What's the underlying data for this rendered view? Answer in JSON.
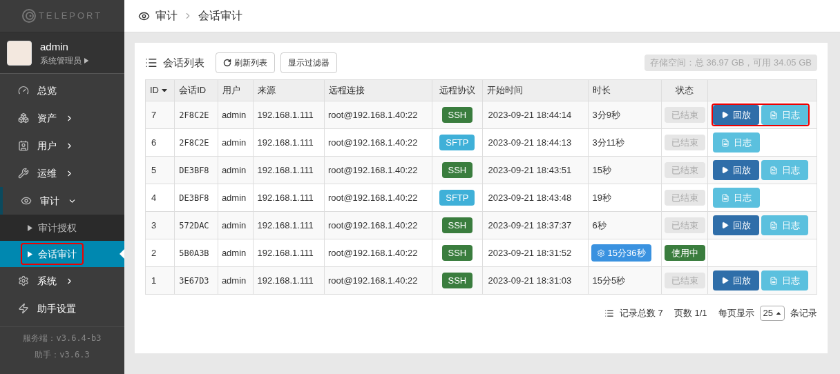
{
  "logo": {
    "text": "TELEPORT"
  },
  "user": {
    "name": "admin",
    "role": "系统管理员"
  },
  "nav": [
    {
      "label": "总览"
    },
    {
      "label": "资产",
      "expandable": true,
      "expanded": false
    },
    {
      "label": "用户",
      "expandable": true,
      "expanded": false
    },
    {
      "label": "运维",
      "expandable": true,
      "expanded": false
    },
    {
      "label": "审计",
      "expandable": true,
      "expanded": true,
      "children": [
        {
          "label": "审计授权",
          "selected": false,
          "highlighted": false
        },
        {
          "label": "会话审计",
          "selected": true,
          "highlighted": true
        }
      ]
    },
    {
      "label": "系统",
      "expandable": true,
      "expanded": false
    },
    {
      "label": "助手设置"
    }
  ],
  "versions": [
    "服务端：v3.6.4-b3",
    "助手：v3.6.3"
  ],
  "breadcrumb": [
    "审计",
    "会话审计"
  ],
  "panel": {
    "title": "会话列表",
    "buttons": [
      "刷新列表",
      "显示过滤器"
    ],
    "storage": "存储空间：总 36.97 GB，可用 34.05 GB"
  },
  "table": {
    "columns": [
      "ID",
      "会话ID",
      "用户",
      "来源",
      "远程连接",
      "远程协议",
      "开始时间",
      "时长",
      "状态"
    ],
    "rows": [
      {
        "id": "7",
        "session_id": "2F8C2E",
        "user": "admin",
        "source": "192.168.1.111",
        "remote": "root@192.168.1.40:22",
        "protocol": "SSH",
        "start": "2023-09-21 18:44:14",
        "duration": "3分9秒",
        "running": false,
        "status": "已结束",
        "highlighted": true,
        "actions": [
          {
            "kind": "play",
            "label": "回放"
          },
          {
            "kind": "log",
            "label": "日志"
          }
        ]
      },
      {
        "id": "6",
        "session_id": "2F8C2E",
        "user": "admin",
        "source": "192.168.1.111",
        "remote": "root@192.168.1.40:22",
        "protocol": "SFTP",
        "start": "2023-09-21 18:44:13",
        "duration": "3分11秒",
        "running": false,
        "status": "已结束",
        "actions": [
          {
            "kind": "log",
            "label": "日志"
          }
        ]
      },
      {
        "id": "5",
        "session_id": "DE3BF8",
        "user": "admin",
        "source": "192.168.1.111",
        "remote": "root@192.168.1.40:22",
        "protocol": "SSH",
        "start": "2023-09-21 18:43:51",
        "duration": "15秒",
        "running": false,
        "status": "已结束",
        "actions": [
          {
            "kind": "play",
            "label": "回放"
          },
          {
            "kind": "log",
            "label": "日志"
          }
        ]
      },
      {
        "id": "4",
        "session_id": "DE3BF8",
        "user": "admin",
        "source": "192.168.1.111",
        "remote": "root@192.168.1.40:22",
        "protocol": "SFTP",
        "start": "2023-09-21 18:43:48",
        "duration": "19秒",
        "running": false,
        "status": "已结束",
        "actions": [
          {
            "kind": "log",
            "label": "日志"
          }
        ]
      },
      {
        "id": "3",
        "session_id": "572DAC",
        "user": "admin",
        "source": "192.168.1.111",
        "remote": "root@192.168.1.40:22",
        "protocol": "SSH",
        "start": "2023-09-21 18:37:37",
        "duration": "6秒",
        "running": false,
        "status": "已结束",
        "actions": [
          {
            "kind": "play",
            "label": "回放"
          },
          {
            "kind": "log",
            "label": "日志"
          }
        ]
      },
      {
        "id": "2",
        "session_id": "5B0A3B",
        "user": "admin",
        "source": "192.168.1.111",
        "remote": "root@192.168.1.40:22",
        "protocol": "SSH",
        "start": "2023-09-21 18:31:52",
        "duration": "15分36秒",
        "running": true,
        "status": "使用中"
      },
      {
        "id": "1",
        "session_id": "3E67D3",
        "user": "admin",
        "source": "192.168.1.111",
        "remote": "root@192.168.1.40:22",
        "protocol": "SSH",
        "start": "2023-09-21 18:31:03",
        "duration": "15分5秒",
        "running": false,
        "status": "已结束",
        "actions": [
          {
            "kind": "play",
            "label": "回放"
          },
          {
            "kind": "log",
            "label": "日志"
          }
        ]
      }
    ]
  },
  "pager": {
    "total": "记录总数 7",
    "pages": "页数 1/1",
    "per_page_label": "每页显示",
    "per_page": "25",
    "suffix": "条记录"
  }
}
